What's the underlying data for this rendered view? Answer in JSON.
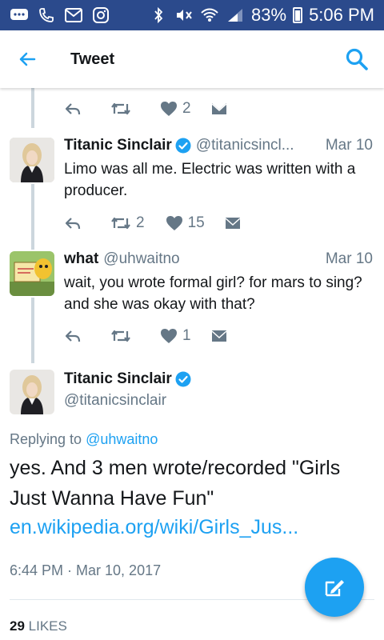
{
  "status_bar": {
    "battery": "83%",
    "time": "5:06 PM"
  },
  "header": {
    "title": "Tweet"
  },
  "top_actions": {
    "like_count": "2"
  },
  "reply1": {
    "name": "Titanic Sinclair",
    "handle": "@titanicsincl...",
    "date": "Mar 10",
    "text": "Limo was all me. Electric was written with a producer.",
    "retweet_count": "2",
    "like_count": "15"
  },
  "reply2": {
    "name": "what",
    "handle": "@uhwaitno",
    "date": "Mar 10",
    "text": "wait, you wrote formal girl? for mars to sing? and she was okay with that?",
    "like_count": "1"
  },
  "main_tweet": {
    "name": "Titanic Sinclair",
    "handle": "@titanicsinclair",
    "replying_prefix": "Replying to",
    "replying_to": "@uhwaitno",
    "text": "yes.  And 3 men wrote/recorded \"Girls Just Wanna Have Fun\"",
    "link": "en.wikipedia.org/wiki/Girls_Jus...",
    "timestamp": "6:44 PM · Mar 10, 2017",
    "likes_count": "29",
    "likes_label": "LIKES"
  },
  "colors": {
    "brand": "#1da1f2",
    "status_bar": "#2b4a8c",
    "muted": "#657786",
    "verified": "#1da1f2"
  }
}
